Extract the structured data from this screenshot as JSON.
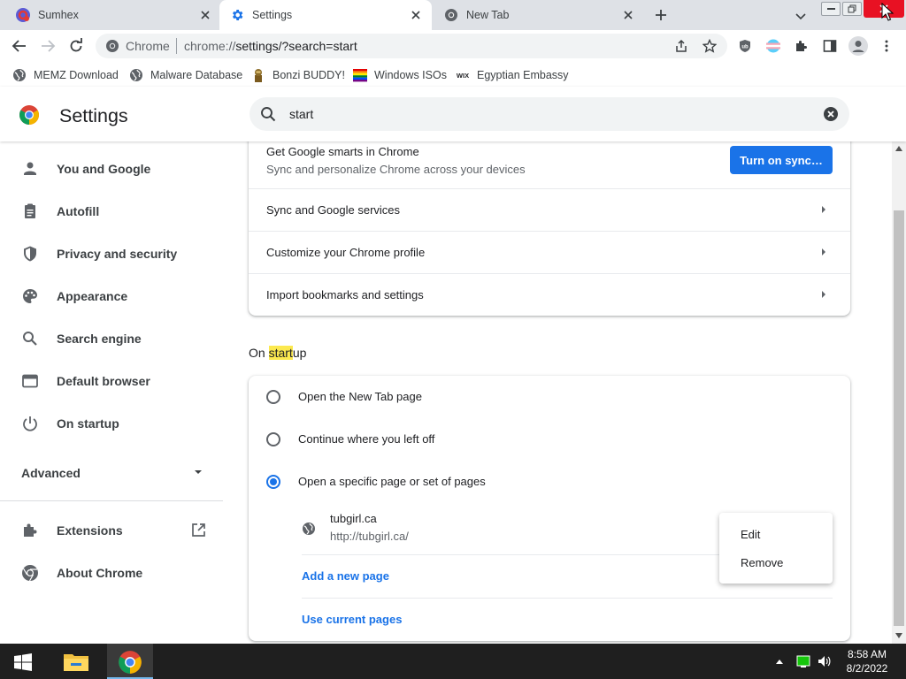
{
  "browser": {
    "tabs": [
      {
        "title": "Sumhex",
        "active": false,
        "icon": "sumhex-favicon"
      },
      {
        "title": "Settings",
        "active": true,
        "icon": "gear-icon"
      },
      {
        "title": "New Tab",
        "active": false,
        "icon": "chrome-icon"
      }
    ],
    "omnibox": {
      "scheme_label": "Chrome",
      "url_host": "chrome://",
      "url_path": "settings/?search=start"
    },
    "bookmarks": [
      {
        "label": "MEMZ Download",
        "icon": "globe-icon"
      },
      {
        "label": "Malware Database",
        "icon": "globe-icon"
      },
      {
        "label": "Bonzi BUDDY!",
        "icon": "bonzi-icon"
      },
      {
        "label": "Windows ISOs",
        "icon": "rainbow-flag-icon"
      },
      {
        "label": "Egyptian Embassy",
        "icon": "wix-icon"
      }
    ]
  },
  "settings": {
    "title": "Settings",
    "search_value": "start"
  },
  "sidebar": {
    "items": [
      {
        "label": "You and Google",
        "icon": "person-icon"
      },
      {
        "label": "Autofill",
        "icon": "clipboard-icon"
      },
      {
        "label": "Privacy and security",
        "icon": "shield-icon"
      },
      {
        "label": "Appearance",
        "icon": "palette-icon"
      },
      {
        "label": "Search engine",
        "icon": "search-icon"
      },
      {
        "label": "Default browser",
        "icon": "browser-window-icon"
      },
      {
        "label": "On startup",
        "icon": "power-icon"
      }
    ],
    "advanced_label": "Advanced",
    "footer_items": [
      {
        "label": "Extensions",
        "icon": "puzzle-icon"
      },
      {
        "label": "About Chrome",
        "icon": "chrome-icon"
      }
    ]
  },
  "you_and_google": {
    "sync_title": "Get Google smarts in Chrome",
    "sync_subtitle": "Sync and personalize Chrome across your devices",
    "sync_button": "Turn on sync…",
    "rows": [
      {
        "label": "Sync and Google services"
      },
      {
        "label": "Customize your Chrome profile"
      },
      {
        "label": "Import bookmarks and settings"
      }
    ]
  },
  "on_startup": {
    "heading_prefix": "On ",
    "heading_highlight": "start",
    "heading_suffix": "up",
    "options": [
      {
        "label": "Open the New Tab page",
        "selected": false
      },
      {
        "label": "Continue where you left off",
        "selected": false
      },
      {
        "label": "Open a specific page or set of pages",
        "selected": true
      }
    ],
    "page": {
      "title": "tubgirl.ca",
      "url": "http://tubgirl.ca/"
    },
    "add_page": "Add a new page",
    "use_current": "Use current pages"
  },
  "context_menu": {
    "items": [
      "Edit",
      "Remove"
    ]
  },
  "taskbar": {
    "time": "8:58 AM",
    "date": "8/2/2022"
  },
  "colors": {
    "accent": "#1a73e8",
    "highlight": "#fce94f",
    "close_button": "#e81123"
  }
}
